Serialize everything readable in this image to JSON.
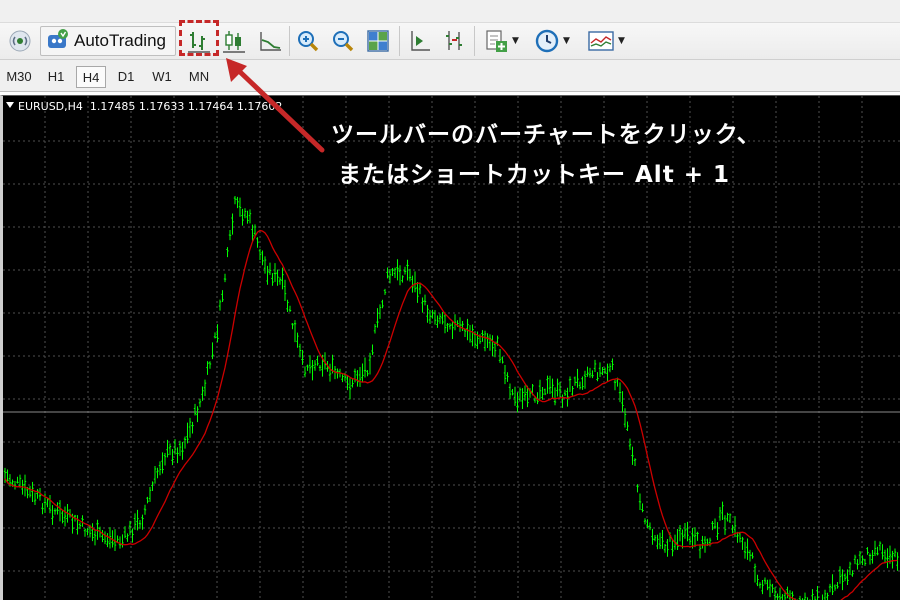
{
  "toolbar": {
    "autotrading_label": "AutoTrading"
  },
  "timeframes": [
    {
      "label": "M30",
      "active": false
    },
    {
      "label": "H1",
      "active": false
    },
    {
      "label": "H4",
      "active": true
    },
    {
      "label": "D1",
      "active": false
    },
    {
      "label": "W1",
      "active": false
    },
    {
      "label": "MN",
      "active": false
    }
  ],
  "chart": {
    "symbol_info": "EURUSD,H4  1.17485 1.17633 1.17464 1.17602",
    "background": "#000000",
    "candle_color": "#00ff00",
    "ma_color": "#cc0000",
    "grid_color": "#4f4f4f"
  },
  "annotation": {
    "line1": "ツールバーのバーチャートをクリック、",
    "line2": "またはショートカットキー Alt + 1",
    "highlight_color": "#c62828"
  },
  "icons": [
    "connection-icon",
    "autotrading-icon",
    "bar-chart-icon",
    "candlestick-icon",
    "line-chart-icon",
    "zoom-in-icon",
    "zoom-out-icon",
    "tile-windows-icon",
    "chart-shift-icon",
    "autoscroll-icon",
    "new-order-icon",
    "periods-icon",
    "templates-icon"
  ]
}
